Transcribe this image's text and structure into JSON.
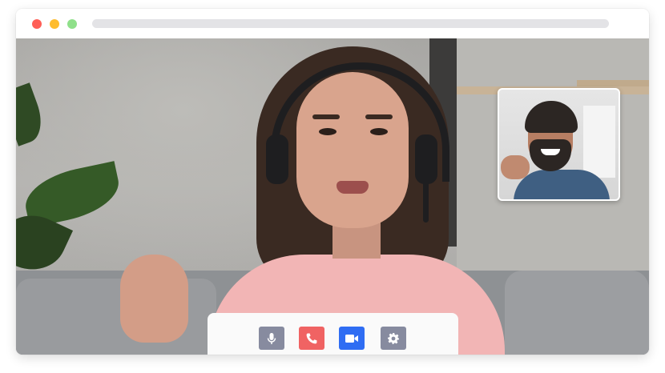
{
  "window": {
    "traffic_lights": [
      "#ff5f57",
      "#febc2e",
      "#8fe08a"
    ]
  },
  "call": {
    "main_participant": "woman-with-headset",
    "pip_participant": "smiling-bearded-man"
  },
  "controls": {
    "mute": {
      "icon": "microphone-icon",
      "color": "#878b9f"
    },
    "hangup": {
      "icon": "phone-icon",
      "color": "#f06363"
    },
    "video": {
      "icon": "video-camera-icon",
      "color": "#2f6df3"
    },
    "settings": {
      "icon": "gear-icon",
      "color": "#878b9f"
    }
  }
}
